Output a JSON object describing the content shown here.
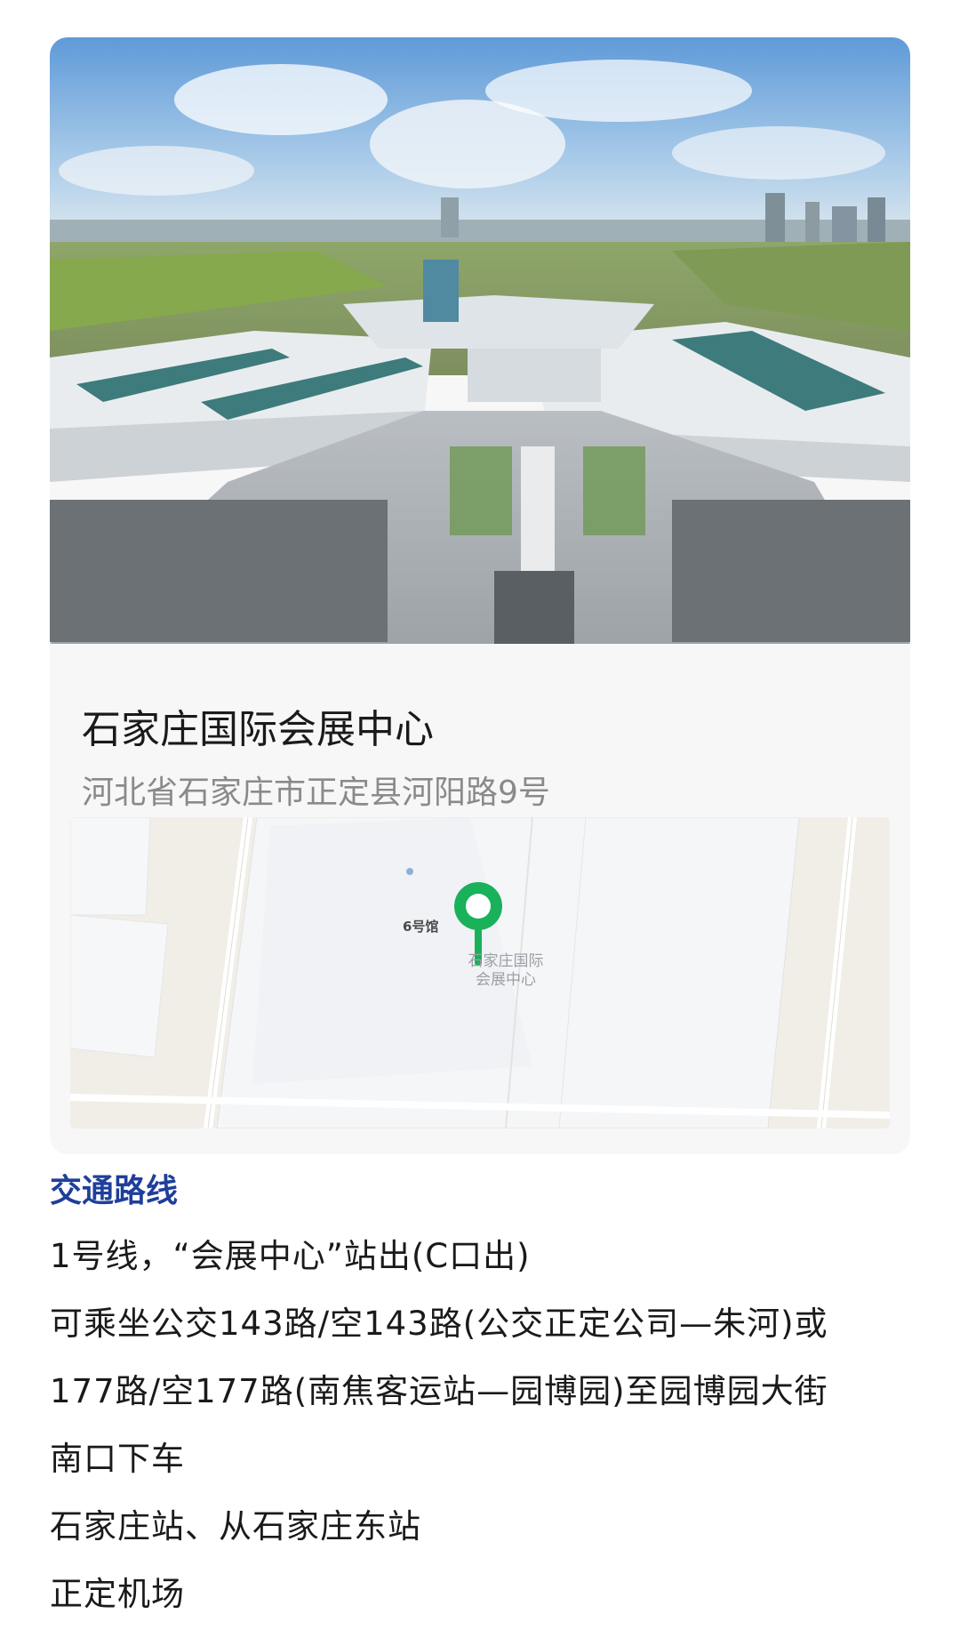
{
  "venue": {
    "name": "石家庄国际会展中心",
    "address": "河北省石家庄市正定县河阳路9号"
  },
  "map": {
    "hall_label": "6号馆",
    "venue_label_line1": "石家庄国际",
    "venue_label_line2": "会展中心",
    "pin_color": "#19b15a"
  },
  "transport": {
    "heading": "交通路线",
    "heading_color": "#1f3f9a",
    "lines": [
      "1号线，“会展中心”站出(C口出)",
      "可乘坐公交143路/空143路(公交正定公司—朱河)或",
      "177路/空177路(南焦客运站—园博园)至园博园大街",
      "南口下车",
      "石家庄站、从石家庄东站",
      "正定机场"
    ]
  }
}
